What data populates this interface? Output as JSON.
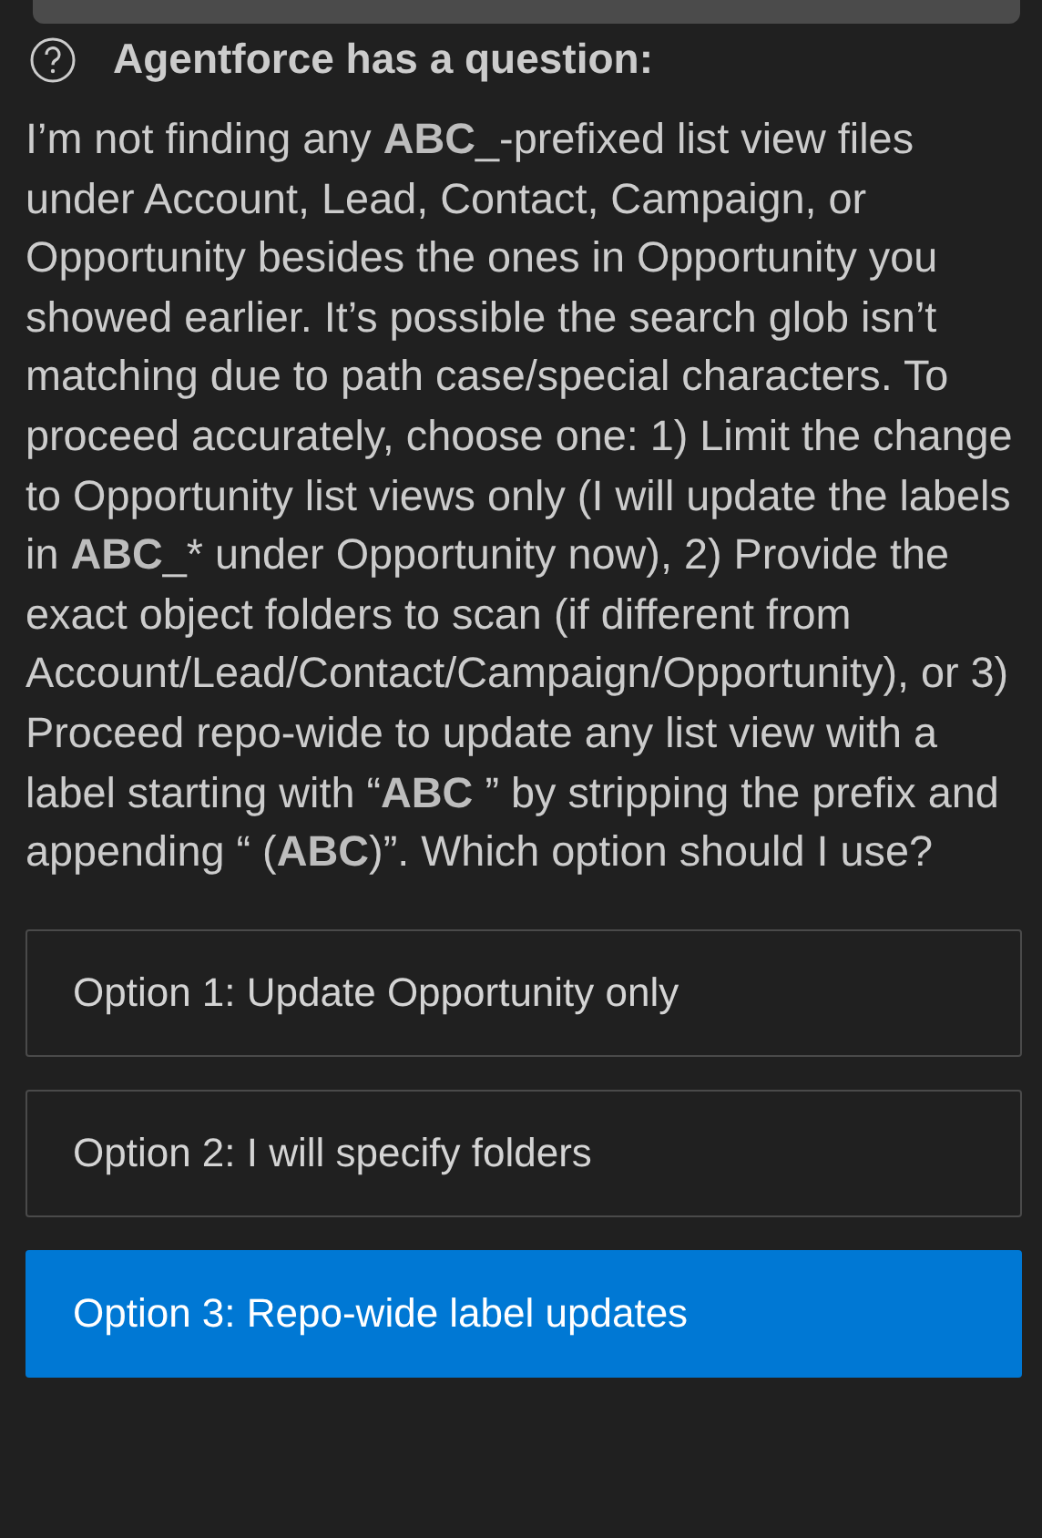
{
  "question": {
    "title": "Agentforce has a question:",
    "text": "I’m not finding any **ABC**_-prefixed list view files under Account, Lead, Contact, Campaign, or Opportunity besides the ones in Opportunity you showed earlier. It’s possible the search glob isn’t matching due to path case/special characters. To proceed accurately, choose one: 1) Limit the change to Opportunity list views only (I will update the labels in **ABC**_* under Opportunity now), 2) Provide the exact object folders to scan (if different from Account/Lead/Contact/Campaign/Opportunity), or 3) Proceed repo-wide to update any list view with a label starting with “**ABC** ” by stripping the prefix and appending “ (**ABC**)”. Which option should I use?"
  },
  "options": [
    {
      "label": "Option 1: Update Opportunity only",
      "selected": false
    },
    {
      "label": "Option 2: I will specify folders",
      "selected": false
    },
    {
      "label": "Option 3: Repo-wide label updates",
      "selected": true
    }
  ]
}
